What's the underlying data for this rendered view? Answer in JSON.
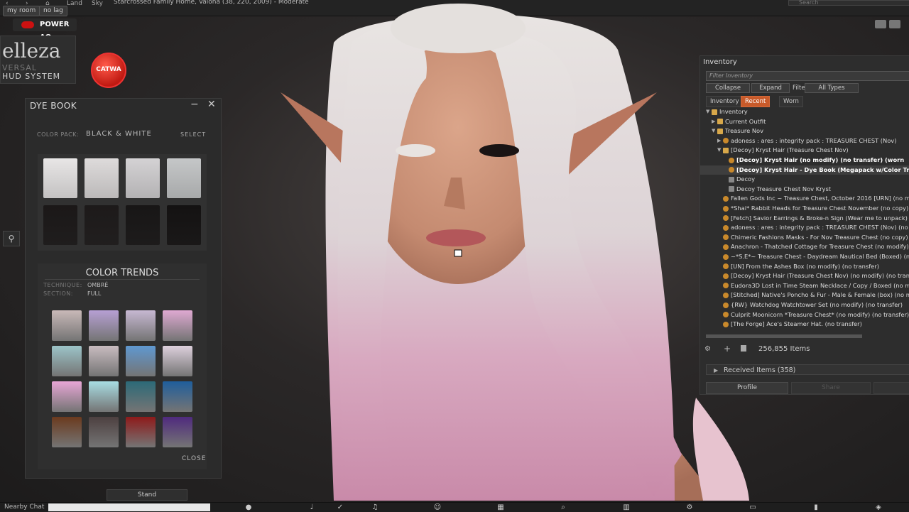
{
  "topbar": {
    "nav_back": "‹",
    "nav_fwd": "›",
    "home_label": "Land",
    "sky_label": "Sky",
    "location": "Starcrossed Family Home, Valona (38, 220, 2009) - Moderate",
    "search_placeholder": "Search",
    "tabs": [
      "my room",
      "no lag"
    ]
  },
  "hud": {
    "power_ao": "POWER AO",
    "belleza_brand": "elleza",
    "belleza_sub1": "VERSAL",
    "belleza_sub2": "HUD SYSTEM",
    "catwa": "CATWA"
  },
  "dyebook": {
    "title": "DYE BOOK",
    "color_pack_label": "COLOR PACK:",
    "color_pack_value": "BLACK & WHITE",
    "select_label": "SELECT",
    "trends_title": "COLOR TRENDS",
    "technique_label": "TECHNIQUE:",
    "technique_value": "OMBRÉ",
    "section_label": "SECTION:",
    "section_value": "FULL",
    "close_label": "CLOSE",
    "bw_swatches": [
      "#e8e6e6",
      "#dedbdb",
      "#d4d2d4",
      "#c5c7c8",
      "#1b1818",
      "#1d1a1a",
      "#181616",
      "#141212"
    ],
    "trend_swatches": [
      "#c9b9b8",
      "#b7a0d4",
      "#c7b8d2",
      "#dfa9d2",
      "#9cc4c8",
      "#c9bcc0",
      "#5f98d0",
      "#ddd0dc",
      "#e8a6d6",
      "#a8dde3",
      "#2c6a78",
      "#1f5e9c",
      "#6b3a1e",
      "#4d4040",
      "#8e1a1a",
      "#4f2a7e"
    ]
  },
  "stand_label": "Stand",
  "chat": {
    "label": "Nearby Chat",
    "value": ""
  },
  "inventory": {
    "title": "Inventory",
    "filter_placeholder": "Filter Inventory",
    "collapse": "Collapse",
    "expand": "Expand",
    "filter_label": "Filter:",
    "filter_value": "All Types",
    "tabs": [
      "Inventory",
      "Recent",
      "Worn"
    ],
    "rows": [
      {
        "text": "Inventory"
      },
      {
        "text": "Current Outfit"
      },
      {
        "text": "Treasure Nov"
      },
      {
        "text": "adoness : ares : integrity pack : TREASURE CHEST (Nov)"
      },
      {
        "text": "[Decoy] Kryst Hair (Treasure Chest Nov)"
      },
      {
        "text": "[Decoy] Kryst Hair (no modify) (no transfer) (worn"
      },
      {
        "text": "[Decoy] Kryst Hair - Dye Book (Megapack w/Color Tr"
      },
      {
        "text": "Decoy"
      },
      {
        "text": "Decoy Treasure Chest Nov Kryst"
      },
      {
        "text": "Fallen Gods Inc ~ Treasure Chest, October 2016 [URN] (no mo"
      },
      {
        "text": "*Shai* Rabbit Heads for Treasure Chest November (no copy)"
      },
      {
        "text": "[Fetch] Savior Earrings & Broke-n Sign (Wear me to unpack)"
      },
      {
        "text": "adoness : ares : integrity pack : TREASURE CHEST (Nov) (no m"
      },
      {
        "text": "Chimeric Fashions Masks - For Nov Treasure Chest (no copy)"
      },
      {
        "text": "Anachron - Thatched Cottage for Treasure Chest (no modify)"
      },
      {
        "text": "~*S.E*~ Treasure Chest - Daydream Nautical Bed (Boxed) (n"
      },
      {
        "text": "[UN] From the Ashes Box (no modify) (no transfer)"
      },
      {
        "text": "[Decoy] Kryst Hair (Treasure Chest Nov) (no modify) (no trans"
      },
      {
        "text": "Eudora3D Lost in Time Steam Necklace / Copy / Boxed (no mo"
      },
      {
        "text": "[Stitched] Native's Poncho & Fur - Male & Female (box) (no mo"
      },
      {
        "text": "{RW} Watchdog Watchtower Set (no modify) (no transfer)"
      },
      {
        "text": "Culprit Moonicorn *Treasure Chest* (no modify) (no transfer)"
      },
      {
        "text": "[The Forge] Ace's Steamer Hat. (no transfer)"
      }
    ],
    "item_count": "256,855 Items",
    "received": "Received Items (358)",
    "profile": "Profile",
    "share": "Share"
  },
  "colors": {
    "accent": "#c85a2a",
    "catwa_red": "#d4201a",
    "panel_bg": "#2b2b2b"
  }
}
